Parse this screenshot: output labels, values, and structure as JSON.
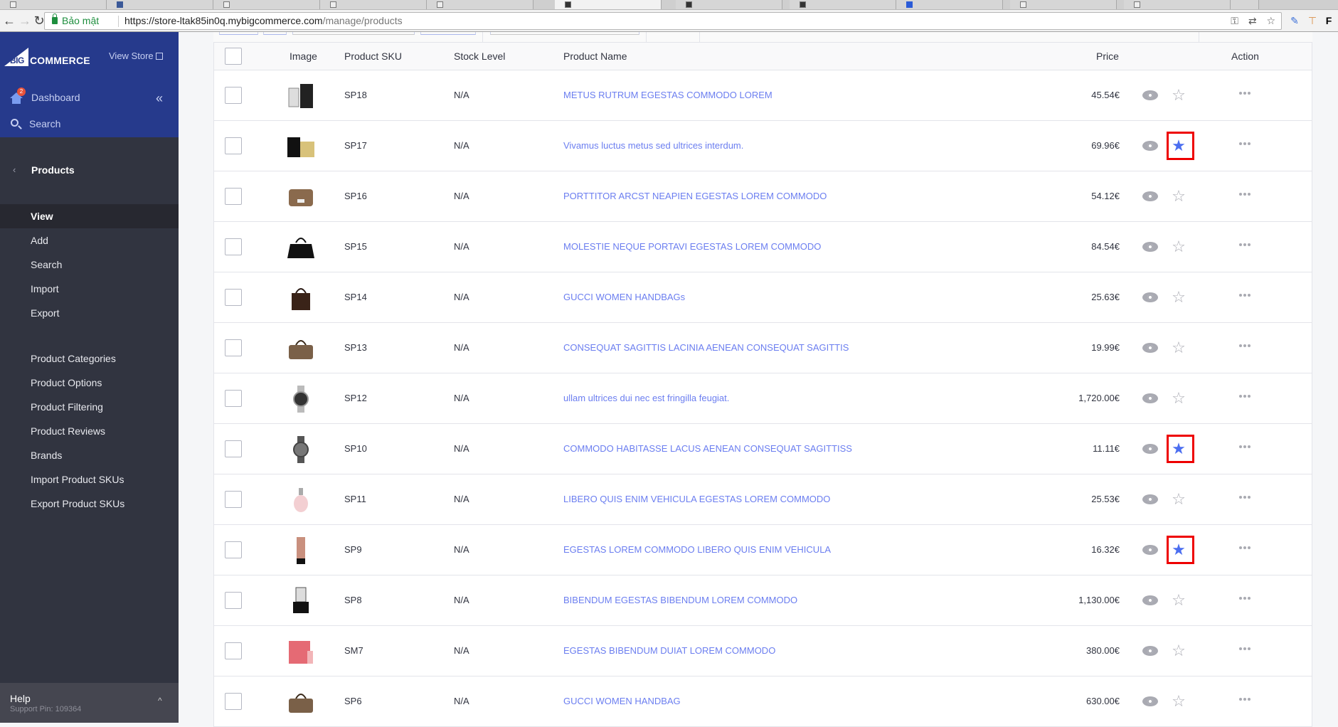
{
  "browser": {
    "secure_label": "Bảo mật",
    "url_host": "https://store-ltak85in0q.mybigcommerce.com",
    "url_path": "/manage/products"
  },
  "sidebar": {
    "brand": {
      "big": "BIG",
      "commerce": "COMMERCE"
    },
    "view_store": "View Store",
    "dashboard": {
      "label": "Dashboard",
      "badge": "2"
    },
    "search": "Search",
    "section": "Products",
    "menu": [
      {
        "label": "View",
        "active": true
      },
      {
        "label": "Add"
      },
      {
        "label": "Search"
      },
      {
        "label": "Import"
      },
      {
        "label": "Export"
      }
    ],
    "menu2": [
      {
        "label": "Product Categories"
      },
      {
        "label": "Product Options"
      },
      {
        "label": "Product Filtering"
      },
      {
        "label": "Product Reviews"
      },
      {
        "label": "Brands"
      },
      {
        "label": "Import Product SKUs"
      },
      {
        "label": "Export Product SKUs"
      }
    ],
    "footer": {
      "help": "Help",
      "pin": "Support Pin: 109364"
    }
  },
  "table": {
    "headers": {
      "image": "Image",
      "sku": "Product SKU",
      "stock": "Stock Level",
      "name": "Product Name",
      "price": "Price",
      "action": "Action"
    },
    "rows": [
      {
        "sku": "SP18",
        "stock": "N/A",
        "name": "METUS RUTRUM EGESTAS COMMODO LOREM",
        "price": "45.54€",
        "featured": false,
        "highlighted": false,
        "thumb": "perfume-bottle"
      },
      {
        "sku": "SP17",
        "stock": "N/A",
        "name": "Vivamus luctus metus sed ultrices interdum.",
        "price": "69.96€",
        "featured": true,
        "highlighted": true,
        "thumb": "perfume-box"
      },
      {
        "sku": "SP16",
        "stock": "N/A",
        "name": "PORTTITOR ARCST NEAPIEN EGESTAS LOREM COMMODO",
        "price": "54.12€",
        "featured": false,
        "highlighted": false,
        "thumb": "crossbody-bag"
      },
      {
        "sku": "SP15",
        "stock": "N/A",
        "name": "MOLESTIE NEQUE PORTAVI EGESTAS LOREM COMMODO",
        "price": "84.54€",
        "featured": false,
        "highlighted": false,
        "thumb": "black-handbag"
      },
      {
        "sku": "SP14",
        "stock": "N/A",
        "name": "GUCCI WOMEN HANDBAGs",
        "price": "25.63€",
        "featured": false,
        "highlighted": false,
        "thumb": "brown-handbag"
      },
      {
        "sku": "SP13",
        "stock": "N/A",
        "name": "CONSEQUAT SAGITTIS LACINIA AENEAN CONSEQUAT SAGITTIS",
        "price": "19.99€",
        "featured": false,
        "highlighted": false,
        "thumb": "duffel-bag"
      },
      {
        "sku": "SP12",
        "stock": "N/A",
        "name": "ullam ultrices dui nec est fringilla feugiat.",
        "price": "1,720.00€",
        "featured": false,
        "highlighted": false,
        "thumb": "watch"
      },
      {
        "sku": "SP10",
        "stock": "N/A",
        "name": "COMMODO HABITASSE LACUS AENEAN CONSEQUAT SAGITTISS",
        "price": "11.11€",
        "featured": true,
        "highlighted": true,
        "thumb": "watch-dark"
      },
      {
        "sku": "SP11",
        "stock": "N/A",
        "name": "LIBERO QUIS ENIM VEHICULA EGESTAS LOREM COMMODO",
        "price": "25.53€",
        "featured": false,
        "highlighted": false,
        "thumb": "pink-perfume"
      },
      {
        "sku": "SP9",
        "stock": "N/A",
        "name": "EGESTAS LOREM COMMODO LIBERO QUIS ENIM VEHICULA",
        "price": "16.32€",
        "featured": true,
        "highlighted": true,
        "thumb": "cream-tube"
      },
      {
        "sku": "SP8",
        "stock": "N/A",
        "name": "BIBENDUM EGESTAS BIBENDUM LOREM COMMODO",
        "price": "1,130.00€",
        "featured": false,
        "highlighted": false,
        "thumb": "food-processor"
      },
      {
        "sku": "SM7",
        "stock": "N/A",
        "name": "EGESTAS BIBENDUM DUIAT LOREM COMMODO",
        "price": "380.00€",
        "featured": false,
        "highlighted": false,
        "thumb": "gift-set"
      },
      {
        "sku": "SP6",
        "stock": "N/A",
        "name": "GUCCI WOMEN HANDBAG",
        "price": "630.00€",
        "featured": false,
        "highlighted": false,
        "thumb": "duffel-bag"
      }
    ]
  },
  "colors": {
    "sidebar_top": "#263a8c",
    "sidebar": "#313440",
    "link": "#6b7ef0",
    "star_active": "#4b6ef0",
    "highlight": "#ee0000"
  }
}
